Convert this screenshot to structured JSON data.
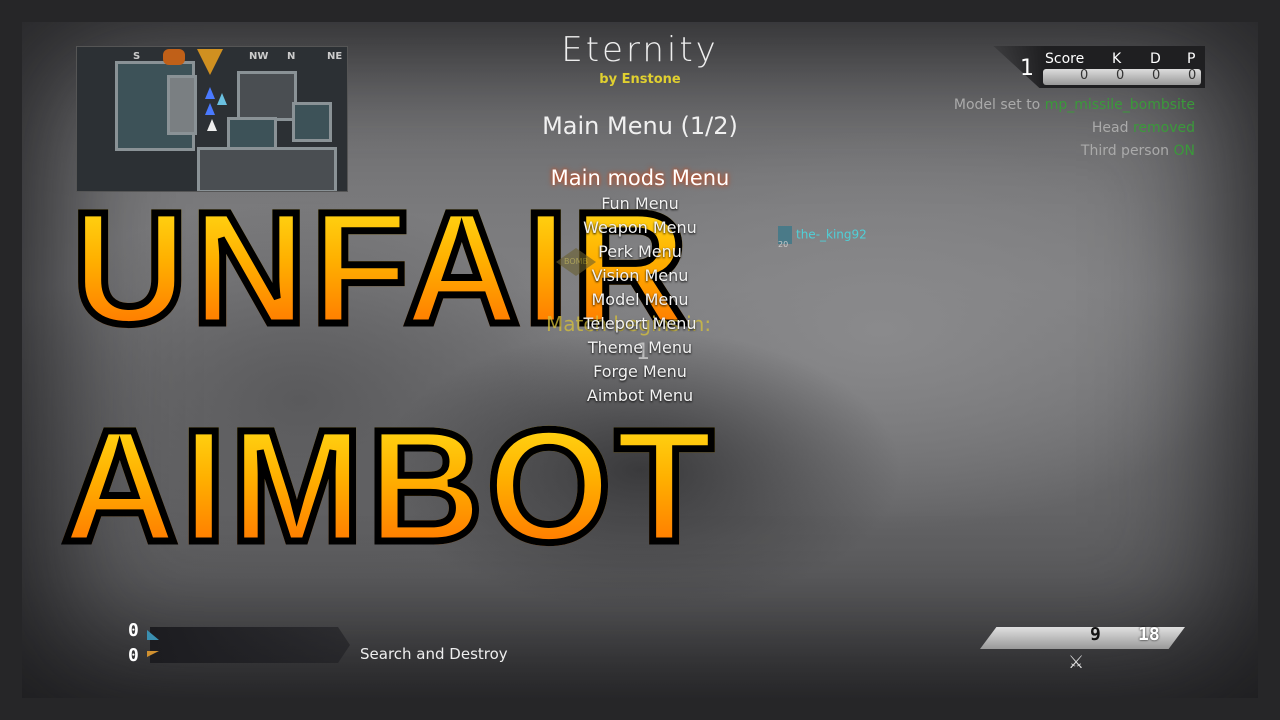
{
  "thumbnail": {
    "line1": "UNFAIR",
    "line2": "AIMBOT"
  },
  "mod_menu": {
    "title": "Eternity",
    "byline": "by Enstone",
    "menu_title": "Main Menu (1/2)",
    "selected": "Main mods Menu",
    "items": [
      "Fun Menu",
      "Weapon Menu",
      "Perk Menu",
      "Vision Menu",
      "Model Menu",
      "Teleport Menu",
      "Theme Menu",
      "Forge Menu",
      "Aimbot Menu"
    ]
  },
  "match": {
    "countdown_label": "Match begins in:",
    "countdown_value": "1"
  },
  "minimap": {
    "compass": [
      "S",
      "NW",
      "N",
      "NE"
    ]
  },
  "scoreboard": {
    "rank": "1",
    "headers": [
      "Score",
      "K",
      "D",
      "P"
    ],
    "values": [
      "0",
      "0",
      "0",
      "0"
    ]
  },
  "feed": [
    {
      "text": "Model set to ",
      "highlight": "mp_missile_bombsite"
    },
    {
      "text": "Head ",
      "highlight": "removed"
    },
    {
      "text": "Third person ",
      "highlight": "ON"
    }
  ],
  "player_tag": {
    "name": "the-_king92",
    "rank": "20"
  },
  "objective": {
    "bomb_label": "BOMB"
  },
  "team_scores": {
    "friendly": "0",
    "enemy": "0",
    "friendly_color": "#3a8fb0",
    "enemy_color": "#d09030"
  },
  "game_mode": "Search and Destroy",
  "ammo": {
    "clip": "9",
    "reserve": "18"
  },
  "colors": {
    "accent_yellow": "#e0d030",
    "feed_green": "#3a9a3a",
    "player_cyan": "#4fd0d8"
  }
}
